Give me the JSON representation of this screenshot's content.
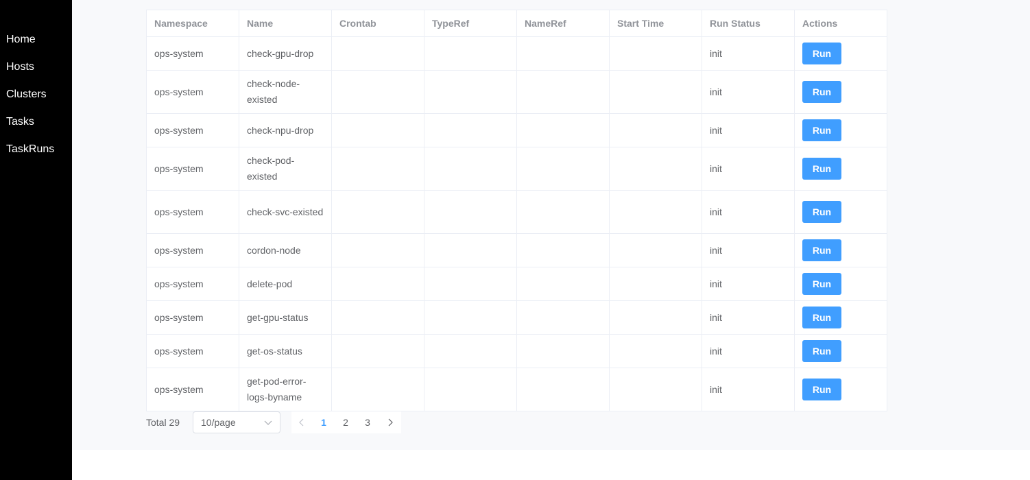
{
  "sidebar": {
    "items": [
      {
        "label": "Home"
      },
      {
        "label": "Hosts"
      },
      {
        "label": "Clusters"
      },
      {
        "label": "Tasks"
      },
      {
        "label": "TaskRuns"
      }
    ]
  },
  "table": {
    "columns": [
      "Namespace",
      "Name",
      "Crontab",
      "TypeRef",
      "NameRef",
      "Start Time",
      "Run Status",
      "Actions"
    ],
    "action_label": "Run",
    "rows": [
      {
        "namespace": "ops-system",
        "name": "check-gpu-drop",
        "crontab": "",
        "typeref": "",
        "nameref": "",
        "start_time": "",
        "run_status": "init"
      },
      {
        "namespace": "ops-system",
        "name": "check-node-existed",
        "crontab": "",
        "typeref": "",
        "nameref": "",
        "start_time": "",
        "run_status": "init"
      },
      {
        "namespace": "ops-system",
        "name": "check-npu-drop",
        "crontab": "",
        "typeref": "",
        "nameref": "",
        "start_time": "",
        "run_status": "init"
      },
      {
        "namespace": "ops-system",
        "name": "check-pod-existed",
        "crontab": "",
        "typeref": "",
        "nameref": "",
        "start_time": "",
        "run_status": "init"
      },
      {
        "namespace": "ops-system",
        "name": "check-svc-existed",
        "crontab": "",
        "typeref": "",
        "nameref": "",
        "start_time": "",
        "run_status": "init"
      },
      {
        "namespace": "ops-system",
        "name": "cordon-node",
        "crontab": "",
        "typeref": "",
        "nameref": "",
        "start_time": "",
        "run_status": "init"
      },
      {
        "namespace": "ops-system",
        "name": "delete-pod",
        "crontab": "",
        "typeref": "",
        "nameref": "",
        "start_time": "",
        "run_status": "init"
      },
      {
        "namespace": "ops-system",
        "name": "get-gpu-status",
        "crontab": "",
        "typeref": "",
        "nameref": "",
        "start_time": "",
        "run_status": "init"
      },
      {
        "namespace": "ops-system",
        "name": "get-os-status",
        "crontab": "",
        "typeref": "",
        "nameref": "",
        "start_time": "",
        "run_status": "init"
      },
      {
        "namespace": "ops-system",
        "name": "get-pod-error-logs-byname",
        "crontab": "",
        "typeref": "",
        "nameref": "",
        "start_time": "",
        "run_status": "init"
      }
    ]
  },
  "pagination": {
    "total_label": "Total 29",
    "page_size": "10/page",
    "pages": [
      "1",
      "2",
      "3"
    ],
    "current_page": "1"
  },
  "icons": {
    "chevron_down": "chevron-down-icon",
    "prev": "chevron-left-icon",
    "next": "chevron-right-icon"
  },
  "colors": {
    "sidebar_bg": "#000000",
    "accent": "#409eff",
    "content_bg": "#f8f9fb",
    "header_text": "#909399",
    "cell_text": "#606266",
    "border": "#ebeef5"
  }
}
